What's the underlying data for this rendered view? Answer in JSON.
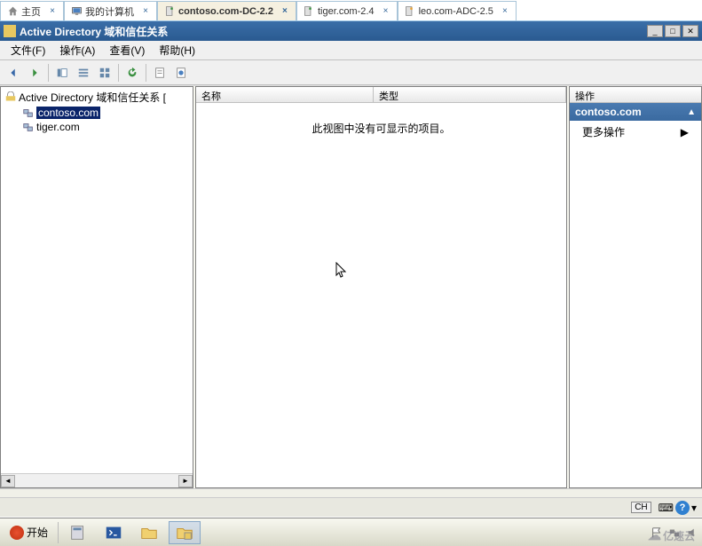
{
  "browser_tabs": [
    {
      "label": "主页",
      "icon": "home-icon"
    },
    {
      "label": "我的计算机",
      "icon": "monitor-icon"
    },
    {
      "label": "contoso.com-DC-2.2",
      "icon": "server-icon",
      "active": true
    },
    {
      "label": "tiger.com-2.4",
      "icon": "server-icon"
    },
    {
      "label": "leo.com-ADC-2.5",
      "icon": "server-icon"
    }
  ],
  "window": {
    "title": "Active Directory 域和信任关系",
    "min": "_",
    "max": "□",
    "close": "✕"
  },
  "menubar": {
    "file": "文件(F)",
    "action": "操作(A)",
    "view": "查看(V)",
    "help": "帮助(H)"
  },
  "toolbar_buttons": [
    "back-icon",
    "forward-icon",
    "sep",
    "panel-icon",
    "list-icon",
    "grid-icon",
    "sep",
    "refresh-icon",
    "sep",
    "props-icon",
    "help-icon"
  ],
  "tree": {
    "root": "Active Directory 域和信任关系 [",
    "items": [
      {
        "label": "contoso.com",
        "selected": true
      },
      {
        "label": "tiger.com",
        "selected": false
      }
    ]
  },
  "list": {
    "columns": {
      "name": "名称",
      "type": "类型"
    },
    "empty_message": "此视图中没有可显示的项目。"
  },
  "actions": {
    "header": "操作",
    "section": "contoso.com",
    "more": "更多操作",
    "arrow": "▶"
  },
  "language_bar": {
    "ch": "CH",
    "kb": "⌨",
    "help": "?",
    "caret": "▾"
  },
  "taskbar": {
    "start": "开始"
  },
  "watermark": "亿速云"
}
